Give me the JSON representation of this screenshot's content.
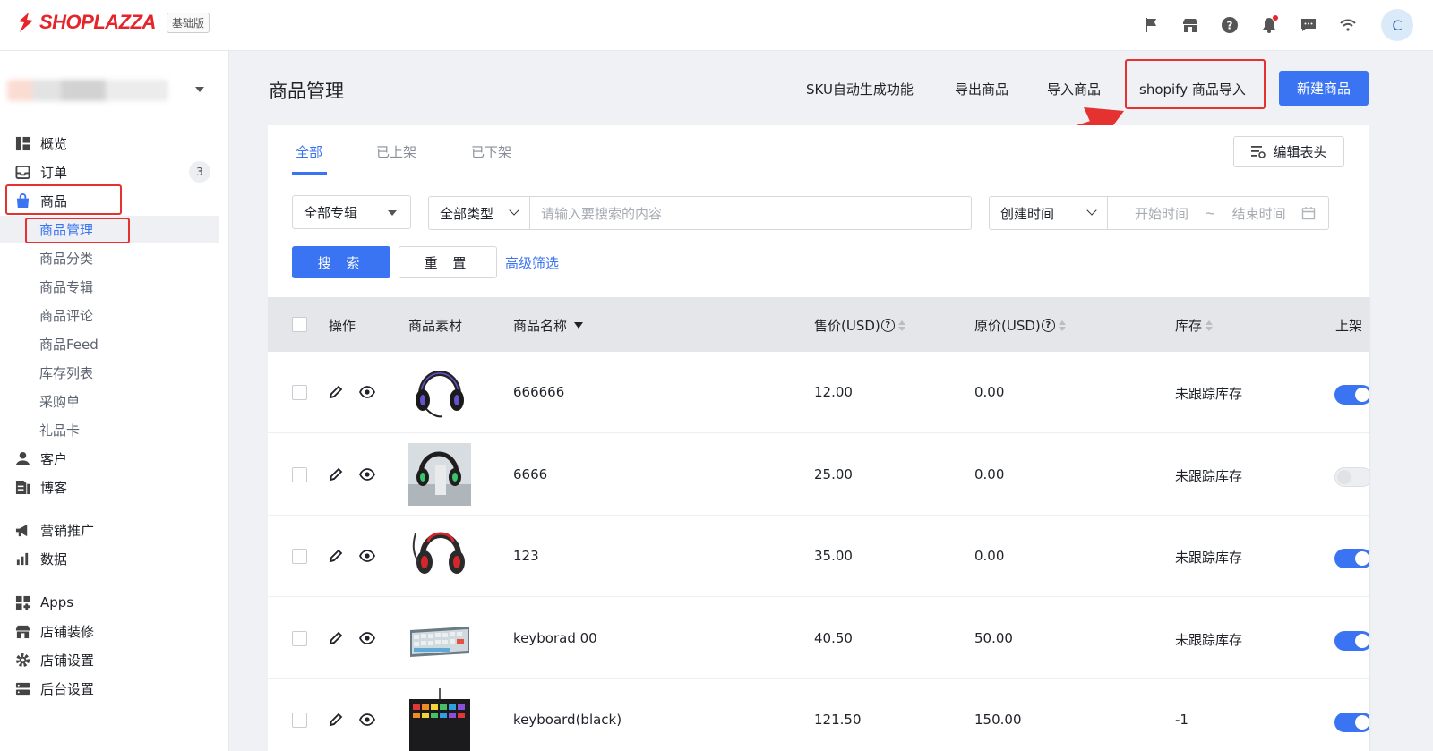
{
  "app": {
    "brand": "SHOPLAZZA",
    "edition": "基础版",
    "avatar_initial": "C",
    "accent_color": "#3b74f2",
    "highlight_color": "#e5312f"
  },
  "topbar_icons": [
    "flag-icon",
    "store-icon",
    "help-icon",
    "bell-icon",
    "message-icon",
    "wifi-icon"
  ],
  "sidebar": {
    "items": [
      {
        "label": "概览",
        "icon": "dashboard-icon"
      },
      {
        "label": "订单",
        "icon": "inbox-icon",
        "count": "3"
      },
      {
        "label": "商品",
        "icon": "bag-icon"
      },
      {
        "label": "客户",
        "icon": "person-icon"
      },
      {
        "label": "博客",
        "icon": "blog-icon"
      },
      {
        "label": "营销推广",
        "icon": "megaphone-icon"
      },
      {
        "label": "数据",
        "icon": "bar-chart-icon"
      },
      {
        "label": "Apps",
        "icon": "apps-icon"
      },
      {
        "label": "店铺装修",
        "icon": "store-icon"
      },
      {
        "label": "店铺设置",
        "icon": "gear-icon"
      },
      {
        "label": "后台设置",
        "icon": "server-icon"
      }
    ],
    "sub_items": [
      "商品管理",
      "商品分类",
      "商品专辑",
      "商品评论",
      "商品Feed",
      "库存列表",
      "采购单",
      "礼品卡"
    ]
  },
  "header": {
    "title": "商品管理",
    "links": [
      "SKU自动生成功能",
      "导出商品",
      "导入商品",
      "shopify 商品导入"
    ],
    "new_button": "新建商品"
  },
  "tabs": [
    "全部",
    "已上架",
    "已下架"
  ],
  "edit_header_button": "编辑表头",
  "filters": {
    "collection": "全部专辑",
    "type": "全部类型",
    "search_placeholder": "请输入要搜索的内容",
    "date_field": "创建时间",
    "start_placeholder": "开始时间",
    "range_sep": "~",
    "end_placeholder": "结束时间",
    "search_button": "搜 索",
    "reset_button": "重 置",
    "advanced_link": "高级筛选"
  },
  "table": {
    "headers": {
      "action": "操作",
      "media": "商品素材",
      "name": "商品名称",
      "price": "售价(USD)",
      "compare_price": "原价(USD)",
      "inventory": "库存",
      "published": "上架"
    },
    "rows": [
      {
        "name": "666666",
        "price": "12.00",
        "compare_price": "0.00",
        "inventory": "未跟踪库存",
        "published": true,
        "thumb": "headset-black-purple"
      },
      {
        "name": "6666",
        "price": "25.00",
        "compare_price": "0.00",
        "inventory": "未跟踪库存",
        "published": false,
        "thumb": "headset-on-stand"
      },
      {
        "name": "123",
        "price": "35.00",
        "compare_price": "0.00",
        "inventory": "未跟踪库存",
        "published": true,
        "thumb": "headset-red"
      },
      {
        "name": "keyborad 00",
        "price": "40.50",
        "compare_price": "50.00",
        "inventory": "未跟踪库存",
        "published": true,
        "thumb": "keyboard-white"
      },
      {
        "name": "keyboard(black)",
        "price": "121.50",
        "compare_price": "150.00",
        "inventory": "-1",
        "published": true,
        "thumb": "keyboard-rgb"
      }
    ]
  }
}
